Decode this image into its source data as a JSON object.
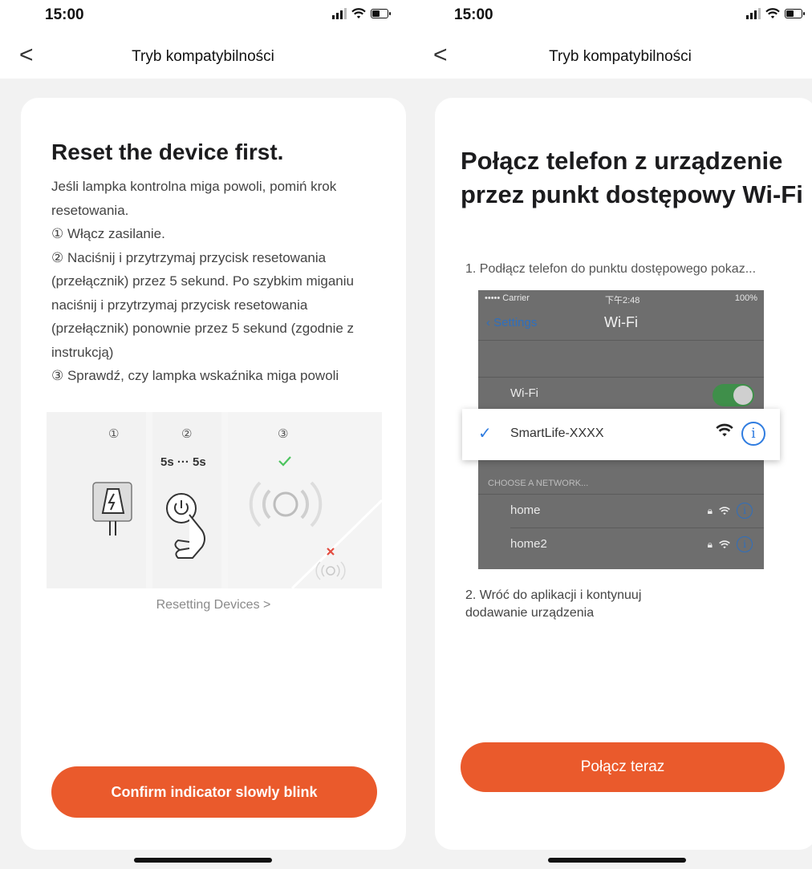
{
  "left": {
    "status": {
      "time": "15:00"
    },
    "nav": {
      "back": "<",
      "title": "Tryb kompatybilności"
    },
    "heading": "Reset the device first.",
    "body": [
      "Jeśli lampka kontrolna miga powoli, pomiń krok resetowania.",
      "① Włącz zasilanie.",
      "② Naciśnij i przytrzymaj przycisk resetowania (przełącznik) przez 5 sekund. Po szybkim miganiu naciśnij i przytrzymaj przycisk resetowania (przełącznik) ponownie przez 5 sekund (zgodnie z instrukcją)",
      "③ Sprawdź, czy lampka wskaźnika miga powoli"
    ],
    "illustration": {
      "step1": "①",
      "step2": "②",
      "step3": "③",
      "timing": "5s ··· 5s"
    },
    "resetting_link": "Resetting Devices >",
    "button": "Confirm indicator slowly blink"
  },
  "right": {
    "status": {
      "time": "15:00"
    },
    "nav": {
      "back": "<",
      "title": "Tryb kompatybilności"
    },
    "heading": "Połącz telefon z urządzenie przez punkt dostępowy Wi-Fi",
    "step1": "1. Podłącz telefon do punktu dostępowego pokaz...",
    "phone": {
      "carrier": "••••• Carrier",
      "clock": "下午2:48",
      "battery": "100%",
      "back": "Settings",
      "title": "Wi-Fi",
      "wifi_row": "Wi-Fi",
      "selected_network": "SmartLife-XXXX",
      "choose": "CHOOSE A NETWORK...",
      "networks": [
        "home",
        "home2"
      ]
    },
    "step2": "2. Wróć do aplikacji i kontynuuj dodawanie urządzenia",
    "button": "Połącz teraz"
  },
  "colors": {
    "accent": "#ea5a2c",
    "ios_blue": "#2f7ce0",
    "toggle_green": "#3f8f4a"
  }
}
